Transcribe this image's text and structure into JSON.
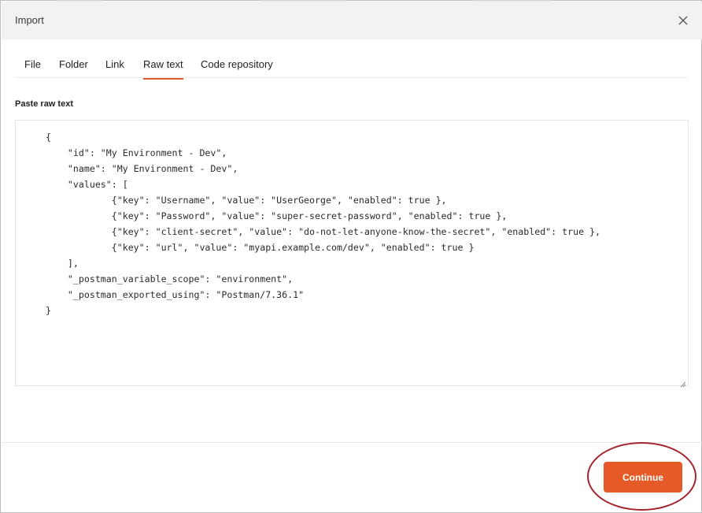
{
  "dialog": {
    "title": "Import"
  },
  "tabs": [
    {
      "label": "File"
    },
    {
      "label": "Folder"
    },
    {
      "label": "Link"
    },
    {
      "label": "Raw text",
      "active": true
    },
    {
      "label": "Code repository"
    }
  ],
  "raw_text": {
    "label": "Paste raw text",
    "value": "{\n    \"id\": \"My Environment - Dev\",\n    \"name\": \"My Environment - Dev\",\n    \"values\": [\n            {\"key\": \"Username\", \"value\": \"UserGeorge\", \"enabled\": true },\n            {\"key\": \"Password\", \"value\": \"super-secret-password\", \"enabled\": true },\n            {\"key\": \"client-secret\", \"value\": \"do-not-let-anyone-know-the-secret\", \"enabled\": true },\n            {\"key\": \"url\", \"value\": \"myapi.example.com/dev\", \"enabled\": true }\n    ],\n    \"_postman_variable_scope\": \"environment\",\n    \"_postman_exported_using\": \"Postman/7.36.1\"\n}"
  },
  "footer": {
    "continue_label": "Continue"
  },
  "colors": {
    "accent": "#e55a26",
    "active_tab_underline": "#e05a2b",
    "annotation_circle": "#a3232e"
  },
  "icons": {
    "close": "close-icon",
    "resize": "resize-handle-icon"
  }
}
